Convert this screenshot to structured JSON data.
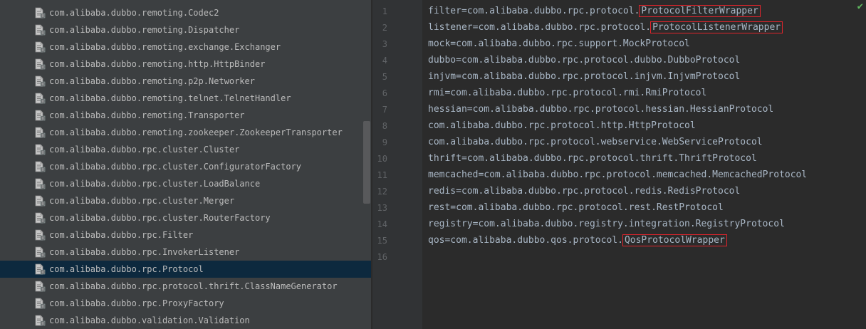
{
  "tree": {
    "items": [
      {
        "label": "com.alibaba.dubbo.remoting.Codec2",
        "selected": false
      },
      {
        "label": "com.alibaba.dubbo.remoting.Dispatcher",
        "selected": false
      },
      {
        "label": "com.alibaba.dubbo.remoting.exchange.Exchanger",
        "selected": false
      },
      {
        "label": "com.alibaba.dubbo.remoting.http.HttpBinder",
        "selected": false
      },
      {
        "label": "com.alibaba.dubbo.remoting.p2p.Networker",
        "selected": false
      },
      {
        "label": "com.alibaba.dubbo.remoting.telnet.TelnetHandler",
        "selected": false
      },
      {
        "label": "com.alibaba.dubbo.remoting.Transporter",
        "selected": false
      },
      {
        "label": "com.alibaba.dubbo.remoting.zookeeper.ZookeeperTransporter",
        "selected": false
      },
      {
        "label": "com.alibaba.dubbo.rpc.cluster.Cluster",
        "selected": false
      },
      {
        "label": "com.alibaba.dubbo.rpc.cluster.ConfiguratorFactory",
        "selected": false
      },
      {
        "label": "com.alibaba.dubbo.rpc.cluster.LoadBalance",
        "selected": false
      },
      {
        "label": "com.alibaba.dubbo.rpc.cluster.Merger",
        "selected": false
      },
      {
        "label": "com.alibaba.dubbo.rpc.cluster.RouterFactory",
        "selected": false
      },
      {
        "label": "com.alibaba.dubbo.rpc.Filter",
        "selected": false
      },
      {
        "label": "com.alibaba.dubbo.rpc.InvokerListener",
        "selected": false
      },
      {
        "label": "com.alibaba.dubbo.rpc.Protocol",
        "selected": true
      },
      {
        "label": "com.alibaba.dubbo.rpc.protocol.thrift.ClassNameGenerator",
        "selected": false
      },
      {
        "label": "com.alibaba.dubbo.rpc.ProxyFactory",
        "selected": false
      },
      {
        "label": "com.alibaba.dubbo.validation.Validation",
        "selected": false
      }
    ],
    "icon": "file-icon"
  },
  "editor": {
    "lines": [
      {
        "num": "1",
        "prefix": "filter=com.alibaba.dubbo.rpc.protocol.",
        "highlight": "ProtocolFilterWrapper"
      },
      {
        "num": "2",
        "prefix": "listener=com.alibaba.dubbo.rpc.protocol.",
        "highlight": "ProtocolListenerWrapper"
      },
      {
        "num": "3",
        "prefix": "mock=com.alibaba.dubbo.rpc.support.MockProtocol",
        "highlight": ""
      },
      {
        "num": "4",
        "prefix": "dubbo=com.alibaba.dubbo.rpc.protocol.dubbo.DubboProtocol",
        "highlight": ""
      },
      {
        "num": "5",
        "prefix": "injvm=com.alibaba.dubbo.rpc.protocol.injvm.InjvmProtocol",
        "highlight": ""
      },
      {
        "num": "6",
        "prefix": "rmi=com.alibaba.dubbo.rpc.protocol.rmi.RmiProtocol",
        "highlight": ""
      },
      {
        "num": "7",
        "prefix": "hessian=com.alibaba.dubbo.rpc.protocol.hessian.HessianProtocol",
        "highlight": ""
      },
      {
        "num": "8",
        "prefix": "com.alibaba.dubbo.rpc.protocol.http.HttpProtocol",
        "highlight": ""
      },
      {
        "num": "9",
        "prefix": "com.alibaba.dubbo.rpc.protocol.webservice.WebServiceProtocol",
        "highlight": ""
      },
      {
        "num": "10",
        "prefix": "thrift=com.alibaba.dubbo.rpc.protocol.thrift.ThriftProtocol",
        "highlight": ""
      },
      {
        "num": "11",
        "prefix": "memcached=com.alibaba.dubbo.rpc.protocol.memcached.MemcachedProtocol",
        "highlight": ""
      },
      {
        "num": "12",
        "prefix": "redis=com.alibaba.dubbo.rpc.protocol.redis.RedisProtocol",
        "highlight": ""
      },
      {
        "num": "13",
        "prefix": "rest=com.alibaba.dubbo.rpc.protocol.rest.RestProtocol",
        "highlight": ""
      },
      {
        "num": "14",
        "prefix": "registry=com.alibaba.dubbo.registry.integration.RegistryProtocol",
        "highlight": ""
      },
      {
        "num": "15",
        "prefix": "qos=com.alibaba.dubbo.qos.protocol.",
        "highlight": "QosProtocolWrapper"
      },
      {
        "num": "16",
        "prefix": "",
        "highlight": ""
      }
    ],
    "status_icon": "check-icon",
    "colors": {
      "highlight_box": "#e0242c",
      "selection": "#0d293e",
      "check": "#5fb85f"
    }
  }
}
